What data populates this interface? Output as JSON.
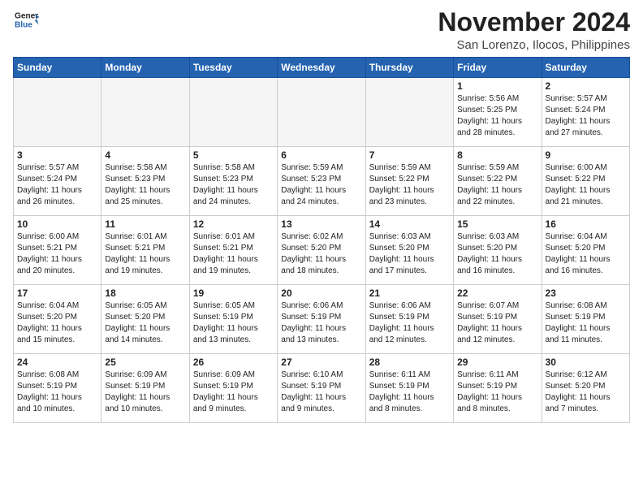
{
  "header": {
    "logo_line1": "General",
    "logo_line2": "Blue",
    "month": "November 2024",
    "location": "San Lorenzo, Ilocos, Philippines"
  },
  "days_of_week": [
    "Sunday",
    "Monday",
    "Tuesday",
    "Wednesday",
    "Thursday",
    "Friday",
    "Saturday"
  ],
  "weeks": [
    [
      {
        "day": "",
        "detail": ""
      },
      {
        "day": "",
        "detail": ""
      },
      {
        "day": "",
        "detail": ""
      },
      {
        "day": "",
        "detail": ""
      },
      {
        "day": "",
        "detail": ""
      },
      {
        "day": "1",
        "detail": "Sunrise: 5:56 AM\nSunset: 5:25 PM\nDaylight: 11 hours\nand 28 minutes."
      },
      {
        "day": "2",
        "detail": "Sunrise: 5:57 AM\nSunset: 5:24 PM\nDaylight: 11 hours\nand 27 minutes."
      }
    ],
    [
      {
        "day": "3",
        "detail": "Sunrise: 5:57 AM\nSunset: 5:24 PM\nDaylight: 11 hours\nand 26 minutes."
      },
      {
        "day": "4",
        "detail": "Sunrise: 5:58 AM\nSunset: 5:23 PM\nDaylight: 11 hours\nand 25 minutes."
      },
      {
        "day": "5",
        "detail": "Sunrise: 5:58 AM\nSunset: 5:23 PM\nDaylight: 11 hours\nand 24 minutes."
      },
      {
        "day": "6",
        "detail": "Sunrise: 5:59 AM\nSunset: 5:23 PM\nDaylight: 11 hours\nand 24 minutes."
      },
      {
        "day": "7",
        "detail": "Sunrise: 5:59 AM\nSunset: 5:22 PM\nDaylight: 11 hours\nand 23 minutes."
      },
      {
        "day": "8",
        "detail": "Sunrise: 5:59 AM\nSunset: 5:22 PM\nDaylight: 11 hours\nand 22 minutes."
      },
      {
        "day": "9",
        "detail": "Sunrise: 6:00 AM\nSunset: 5:22 PM\nDaylight: 11 hours\nand 21 minutes."
      }
    ],
    [
      {
        "day": "10",
        "detail": "Sunrise: 6:00 AM\nSunset: 5:21 PM\nDaylight: 11 hours\nand 20 minutes."
      },
      {
        "day": "11",
        "detail": "Sunrise: 6:01 AM\nSunset: 5:21 PM\nDaylight: 11 hours\nand 19 minutes."
      },
      {
        "day": "12",
        "detail": "Sunrise: 6:01 AM\nSunset: 5:21 PM\nDaylight: 11 hours\nand 19 minutes."
      },
      {
        "day": "13",
        "detail": "Sunrise: 6:02 AM\nSunset: 5:20 PM\nDaylight: 11 hours\nand 18 minutes."
      },
      {
        "day": "14",
        "detail": "Sunrise: 6:03 AM\nSunset: 5:20 PM\nDaylight: 11 hours\nand 17 minutes."
      },
      {
        "day": "15",
        "detail": "Sunrise: 6:03 AM\nSunset: 5:20 PM\nDaylight: 11 hours\nand 16 minutes."
      },
      {
        "day": "16",
        "detail": "Sunrise: 6:04 AM\nSunset: 5:20 PM\nDaylight: 11 hours\nand 16 minutes."
      }
    ],
    [
      {
        "day": "17",
        "detail": "Sunrise: 6:04 AM\nSunset: 5:20 PM\nDaylight: 11 hours\nand 15 minutes."
      },
      {
        "day": "18",
        "detail": "Sunrise: 6:05 AM\nSunset: 5:20 PM\nDaylight: 11 hours\nand 14 minutes."
      },
      {
        "day": "19",
        "detail": "Sunrise: 6:05 AM\nSunset: 5:19 PM\nDaylight: 11 hours\nand 13 minutes."
      },
      {
        "day": "20",
        "detail": "Sunrise: 6:06 AM\nSunset: 5:19 PM\nDaylight: 11 hours\nand 13 minutes."
      },
      {
        "day": "21",
        "detail": "Sunrise: 6:06 AM\nSunset: 5:19 PM\nDaylight: 11 hours\nand 12 minutes."
      },
      {
        "day": "22",
        "detail": "Sunrise: 6:07 AM\nSunset: 5:19 PM\nDaylight: 11 hours\nand 12 minutes."
      },
      {
        "day": "23",
        "detail": "Sunrise: 6:08 AM\nSunset: 5:19 PM\nDaylight: 11 hours\nand 11 minutes."
      }
    ],
    [
      {
        "day": "24",
        "detail": "Sunrise: 6:08 AM\nSunset: 5:19 PM\nDaylight: 11 hours\nand 10 minutes."
      },
      {
        "day": "25",
        "detail": "Sunrise: 6:09 AM\nSunset: 5:19 PM\nDaylight: 11 hours\nand 10 minutes."
      },
      {
        "day": "26",
        "detail": "Sunrise: 6:09 AM\nSunset: 5:19 PM\nDaylight: 11 hours\nand 9 minutes."
      },
      {
        "day": "27",
        "detail": "Sunrise: 6:10 AM\nSunset: 5:19 PM\nDaylight: 11 hours\nand 9 minutes."
      },
      {
        "day": "28",
        "detail": "Sunrise: 6:11 AM\nSunset: 5:19 PM\nDaylight: 11 hours\nand 8 minutes."
      },
      {
        "day": "29",
        "detail": "Sunrise: 6:11 AM\nSunset: 5:19 PM\nDaylight: 11 hours\nand 8 minutes."
      },
      {
        "day": "30",
        "detail": "Sunrise: 6:12 AM\nSunset: 5:20 PM\nDaylight: 11 hours\nand 7 minutes."
      }
    ]
  ]
}
